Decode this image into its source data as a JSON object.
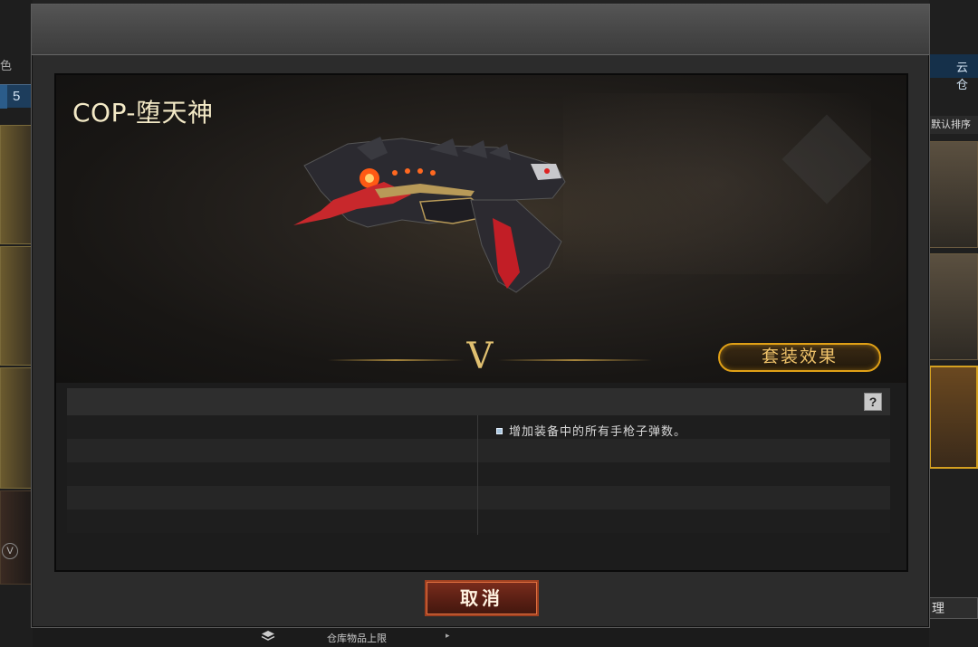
{
  "dialog": {
    "weapon_name": "COP-堕天神",
    "rank_badge": "V",
    "suit_button_label": "套装效果",
    "help_label": "?",
    "effect_text": "增加装备中的所有手枪子弹数。",
    "cancel_label": "取消"
  },
  "background": {
    "left_tab_number": "5",
    "left_strip_text": "色",
    "left_v_mark": "V",
    "right_tab_label": "云仓",
    "right_sort_label": "默认排序",
    "right_manage_label": "理",
    "bottom_capacity_label": "仓库物品上限",
    "bottom_arrow": "▸"
  },
  "colors": {
    "accent_gold": "#e0a016",
    "title_cream": "#f3e9c6",
    "cancel_red": "#7a2c1c"
  },
  "icons": {
    "help": "question-mark-icon",
    "bullet": "bullet-square-icon",
    "layers": "layers-icon"
  }
}
